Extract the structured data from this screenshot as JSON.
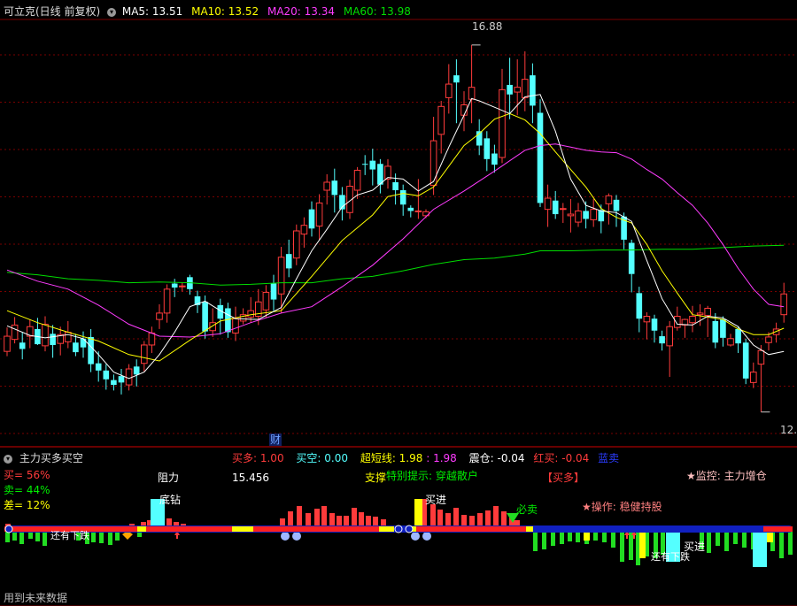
{
  "header": {
    "title": "可立克(日线 前复权)",
    "ma5": "MA5: 13.51",
    "ma10": "MA10: 13.52",
    "ma20": "MA20: 13.34",
    "ma60": "MA60: 13.98"
  },
  "colors": {
    "up": "#ff3b3b",
    "down": "#54ffff",
    "ma5": "#ffffff",
    "ma10": "#ffff00",
    "ma20": "#ff3cff",
    "ma60": "#00dd00",
    "grid": "#7a0000"
  },
  "price_labels": {
    "high": "16.88",
    "low": "12."
  },
  "cai_label": "财",
  "indicator": {
    "title": "主力买多买空",
    "buy_more": "买多: 1.00",
    "buy_empty": "买空: 0.00",
    "super_short": "超短线: 1.98",
    "super_short2": ": 1.98",
    "shock": "震仓: -0.04",
    "red_buy": "红买: -0.04",
    "blue_sell": "蓝卖",
    "buy_pct": "买= 56%",
    "sell_pct": "卖= 44%",
    "diff_pct": "差= 12%",
    "resistance_label": "阻力",
    "resistance_value": "15.456",
    "support_label": "支撑",
    "tip": "特别提示: 穿越散户",
    "tag": "【买多】",
    "monitor": "★监控: 主力增仓",
    "operation": "★操作: 稳健持股",
    "future": "用到未来数据",
    "sig_buy1": "买进",
    "sig_buy2": "买进",
    "sig_sell": "必卖",
    "sig_fall1": "还有下跌",
    "sig_fall2": "还有下跌",
    "sig_dip": "底钻"
  },
  "chart_data": {
    "type": "candlestick",
    "price_range": [
      11.9,
      17.2
    ],
    "high_mark": 16.88,
    "candles": [
      [
        13.04,
        13.23,
        13.34,
        12.98
      ],
      [
        13.19,
        13.37,
        13.47,
        13.14
      ],
      [
        13.15,
        13.07,
        13.28,
        12.94
      ],
      [
        13.23,
        13.35,
        13.44,
        13.08
      ],
      [
        13.32,
        13.13,
        13.46,
        13.12
      ],
      [
        13.11,
        13.38,
        13.48,
        13.04
      ],
      [
        13.26,
        13.12,
        13.37,
        12.96
      ],
      [
        13.14,
        13.25,
        13.35,
        12.99
      ],
      [
        13.16,
        13.28,
        13.42,
        13.08
      ],
      [
        13.15,
        13.03,
        13.26,
        12.98
      ],
      [
        13.2,
        13.09,
        13.29,
        12.96
      ],
      [
        13.22,
        12.88,
        13.32,
        12.78
      ],
      [
        12.89,
        12.8,
        13.04,
        12.66
      ],
      [
        12.8,
        12.69,
        12.88,
        12.56
      ],
      [
        12.68,
        12.62,
        12.75,
        12.55
      ],
      [
        12.73,
        12.65,
        12.82,
        12.5
      ],
      [
        12.62,
        12.82,
        12.88,
        12.55
      ],
      [
        12.85,
        12.75,
        12.94,
        12.6
      ],
      [
        12.89,
        13.12,
        13.17,
        12.79
      ],
      [
        13.12,
        13.27,
        13.35,
        13.02
      ],
      [
        13.44,
        13.52,
        13.63,
        13.32
      ],
      [
        13.52,
        13.82,
        13.88,
        13.4
      ],
      [
        13.89,
        13.84,
        13.95,
        13.72
      ],
      [
        13.86,
        13.86,
        13.9,
        13.79
      ],
      [
        13.97,
        13.82,
        14.0,
        13.75
      ],
      [
        13.73,
        13.62,
        13.8,
        13.52
      ],
      [
        13.66,
        13.29,
        13.74,
        13.2
      ],
      [
        13.3,
        13.4,
        13.58,
        13.22
      ],
      [
        13.62,
        13.45,
        13.7,
        13.25
      ],
      [
        13.58,
        13.28,
        13.65,
        13.21
      ],
      [
        13.27,
        13.45,
        13.6,
        13.17
      ],
      [
        13.42,
        13.5,
        13.58,
        13.38
      ],
      [
        13.47,
        13.55,
        13.72,
        13.4
      ],
      [
        13.48,
        13.66,
        13.82,
        13.37
      ],
      [
        13.56,
        13.78,
        13.87,
        13.46
      ],
      [
        13.89,
        13.69,
        14.0,
        13.55
      ],
      [
        13.76,
        14.22,
        14.35,
        13.52
      ],
      [
        14.26,
        14.08,
        14.44,
        13.97
      ],
      [
        14.21,
        14.55,
        14.63,
        14.12
      ],
      [
        14.51,
        14.62,
        14.72,
        14.34
      ],
      [
        14.82,
        14.58,
        14.92,
        14.48
      ],
      [
        14.61,
        14.9,
        15.01,
        14.44
      ],
      [
        15.06,
        15.16,
        15.26,
        14.88
      ],
      [
        15.18,
        15.0,
        15.33,
        14.78
      ],
      [
        15.0,
        14.82,
        15.1,
        14.68
      ],
      [
        14.78,
        15.11,
        15.19,
        14.7
      ],
      [
        15.06,
        15.31,
        15.35,
        14.95
      ],
      [
        15.39,
        15.38,
        15.5,
        15.25
      ],
      [
        15.43,
        15.32,
        15.58,
        15.12
      ],
      [
        15.39,
        15.13,
        15.45,
        15.02
      ],
      [
        15.2,
        15.36,
        15.45,
        15.08
      ],
      [
        15.16,
        15.06,
        15.27,
        14.88
      ],
      [
        15.06,
        14.88,
        15.13,
        14.74
      ],
      [
        14.84,
        14.8,
        14.87,
        14.72
      ],
      [
        14.79,
        14.8,
        15.2,
        14.7
      ],
      [
        14.74,
        14.79,
        14.82,
        14.71
      ],
      [
        15.12,
        15.68,
        15.98,
        15.0
      ],
      [
        15.76,
        16.11,
        16.18,
        15.52
      ],
      [
        16.22,
        16.39,
        16.64,
        16.02
      ],
      [
        16.5,
        16.41,
        16.7,
        15.9
      ],
      [
        16.0,
        16.13,
        16.3,
        15.8
      ],
      [
        16.2,
        16.35,
        16.88,
        15.9
      ],
      [
        15.8,
        15.62,
        15.95,
        15.5
      ],
      [
        15.71,
        15.45,
        15.8,
        15.3
      ],
      [
        15.52,
        15.38,
        15.63,
        15.28
      ],
      [
        15.47,
        16.32,
        16.58,
        15.4
      ],
      [
        16.38,
        16.26,
        16.72,
        15.95
      ],
      [
        16.29,
        16.35,
        16.7,
        16.0
      ],
      [
        16.22,
        16.45,
        16.8,
        16.05
      ],
      [
        16.5,
        16.12,
        16.65,
        15.9
      ],
      [
        16.03,
        14.9,
        16.2,
        14.85
      ],
      [
        14.82,
        14.96,
        15.13,
        14.6
      ],
      [
        14.93,
        14.76,
        15.05,
        14.7
      ],
      [
        14.82,
        14.83,
        14.9,
        14.65
      ],
      [
        14.74,
        14.76,
        14.95,
        14.53
      ],
      [
        14.66,
        14.8,
        14.9,
        14.6
      ],
      [
        14.8,
        14.7,
        14.92,
        14.58
      ],
      [
        14.69,
        14.82,
        14.95,
        14.6
      ],
      [
        14.81,
        14.67,
        14.88,
        14.52
      ],
      [
        14.89,
        14.99,
        15.02,
        14.63
      ],
      [
        14.94,
        14.8,
        15.0,
        14.6
      ],
      [
        14.73,
        14.44,
        14.78,
        14.32
      ],
      [
        14.4,
        14.01,
        14.44,
        13.78
      ],
      [
        13.77,
        13.45,
        13.85,
        13.28
      ],
      [
        13.41,
        13.48,
        13.53,
        13.19
      ],
      [
        13.45,
        13.3,
        13.5,
        13.15
      ],
      [
        13.23,
        13.14,
        13.3,
        13.05
      ],
      [
        13.11,
        13.35,
        13.42,
        12.72
      ],
      [
        13.34,
        13.48,
        13.6,
        13.3
      ],
      [
        13.37,
        13.44,
        13.45,
        13.21
      ],
      [
        13.4,
        13.48,
        13.61,
        13.28
      ],
      [
        13.5,
        13.52,
        13.63,
        13.36
      ],
      [
        13.49,
        13.58,
        13.61,
        13.22
      ],
      [
        13.42,
        13.15,
        13.52,
        13.08
      ],
      [
        13.44,
        13.21,
        13.48,
        13.1
      ],
      [
        13.12,
        13.2,
        13.26,
        13.1
      ],
      [
        13.32,
        13.14,
        13.35,
        13.02
      ],
      [
        13.15,
        12.7,
        13.2,
        12.63
      ],
      [
        12.65,
        12.78,
        12.9,
        12.58
      ],
      [
        12.88,
        13.05,
        13.12,
        12.28
      ],
      [
        13.15,
        13.22,
        13.28,
        13.05
      ],
      [
        13.25,
        13.32,
        13.4,
        13.15
      ],
      [
        13.5,
        13.76,
        13.9,
        13.4
      ]
    ],
    "ma5": [
      [
        0,
        13.36
      ],
      [
        3,
        13.24
      ],
      [
        5,
        13.21
      ],
      [
        8,
        13.25
      ],
      [
        10,
        13.2
      ],
      [
        12,
        13.0
      ],
      [
        14,
        12.78
      ],
      [
        16,
        12.7
      ],
      [
        18,
        12.78
      ],
      [
        20,
        13.0
      ],
      [
        22,
        13.28
      ],
      [
        24,
        13.6
      ],
      [
        26,
        13.67
      ],
      [
        28,
        13.55
      ],
      [
        30,
        13.45
      ],
      [
        33,
        13.44
      ],
      [
        36,
        13.59
      ],
      [
        38,
        13.95
      ],
      [
        40,
        14.3
      ],
      [
        42,
        14.57
      ],
      [
        44,
        14.85
      ],
      [
        46,
        15.0
      ],
      [
        48,
        15.06
      ],
      [
        50,
        15.22
      ],
      [
        52,
        15.2
      ],
      [
        54,
        15.05
      ],
      [
        56,
        15.17
      ],
      [
        58,
        15.6
      ],
      [
        60,
        16.0
      ],
      [
        61,
        16.21
      ],
      [
        62,
        16.18
      ],
      [
        64,
        16.1
      ],
      [
        66,
        16.02
      ],
      [
        68,
        16.23
      ],
      [
        70,
        16.26
      ],
      [
        72,
        15.8
      ],
      [
        74,
        15.2
      ],
      [
        76,
        14.87
      ],
      [
        78,
        14.8
      ],
      [
        80,
        14.78
      ],
      [
        82,
        14.67
      ],
      [
        84,
        14.18
      ],
      [
        86,
        13.7
      ],
      [
        88,
        13.38
      ],
      [
        90,
        13.37
      ],
      [
        92,
        13.48
      ],
      [
        94,
        13.46
      ],
      [
        96,
        13.35
      ],
      [
        98,
        13.12
      ],
      [
        100,
        13.0
      ],
      [
        102,
        13.04
      ]
    ],
    "ma10": [
      [
        0,
        13.55
      ],
      [
        4,
        13.4
      ],
      [
        8,
        13.28
      ],
      [
        12,
        13.17
      ],
      [
        16,
        13.0
      ],
      [
        20,
        12.92
      ],
      [
        24,
        13.18
      ],
      [
        28,
        13.42
      ],
      [
        32,
        13.5
      ],
      [
        36,
        13.55
      ],
      [
        40,
        13.98
      ],
      [
        44,
        14.43
      ],
      [
        48,
        14.75
      ],
      [
        50,
        14.98
      ],
      [
        52,
        15.02
      ],
      [
        54,
        14.99
      ],
      [
        56,
        15.1
      ],
      [
        58,
        15.36
      ],
      [
        60,
        15.62
      ],
      [
        62,
        15.77
      ],
      [
        64,
        15.95
      ],
      [
        66,
        16.02
      ],
      [
        68,
        15.94
      ],
      [
        70,
        15.77
      ],
      [
        72,
        15.54
      ],
      [
        74,
        15.32
      ],
      [
        76,
        15.1
      ],
      [
        78,
        14.83
      ],
      [
        80,
        14.72
      ],
      [
        82,
        14.65
      ],
      [
        84,
        14.38
      ],
      [
        86,
        14.05
      ],
      [
        88,
        13.77
      ],
      [
        90,
        13.5
      ],
      [
        92,
        13.47
      ],
      [
        94,
        13.44
      ],
      [
        96,
        13.32
      ],
      [
        98,
        13.25
      ],
      [
        100,
        13.25
      ],
      [
        102,
        13.33
      ]
    ],
    "ma20": [
      [
        0,
        14.06
      ],
      [
        4,
        13.92
      ],
      [
        8,
        13.82
      ],
      [
        12,
        13.62
      ],
      [
        16,
        13.38
      ],
      [
        20,
        13.23
      ],
      [
        24,
        13.22
      ],
      [
        28,
        13.26
      ],
      [
        32,
        13.4
      ],
      [
        36,
        13.52
      ],
      [
        40,
        13.6
      ],
      [
        44,
        13.85
      ],
      [
        48,
        14.12
      ],
      [
        52,
        14.45
      ],
      [
        56,
        14.82
      ],
      [
        60,
        15.05
      ],
      [
        64,
        15.3
      ],
      [
        68,
        15.56
      ],
      [
        70,
        15.62
      ],
      [
        72,
        15.64
      ],
      [
        74,
        15.6
      ],
      [
        76,
        15.56
      ],
      [
        78,
        15.54
      ],
      [
        80,
        15.53
      ],
      [
        82,
        15.45
      ],
      [
        84,
        15.32
      ],
      [
        86,
        15.2
      ],
      [
        88,
        15.03
      ],
      [
        90,
        14.87
      ],
      [
        92,
        14.65
      ],
      [
        94,
        14.38
      ],
      [
        96,
        14.08
      ],
      [
        98,
        13.82
      ],
      [
        100,
        13.63
      ],
      [
        102,
        13.6
      ]
    ],
    "ma60": [
      [
        0,
        14.03
      ],
      [
        4,
        14.0
      ],
      [
        8,
        13.95
      ],
      [
        12,
        13.93
      ],
      [
        16,
        13.9
      ],
      [
        20,
        13.91
      ],
      [
        24,
        13.9
      ],
      [
        28,
        13.87
      ],
      [
        32,
        13.88
      ],
      [
        36,
        13.9
      ],
      [
        40,
        13.9
      ],
      [
        44,
        13.95
      ],
      [
        48,
        13.98
      ],
      [
        52,
        14.05
      ],
      [
        56,
        14.13
      ],
      [
        60,
        14.19
      ],
      [
        64,
        14.21
      ],
      [
        68,
        14.26
      ],
      [
        70,
        14.3
      ],
      [
        74,
        14.3
      ],
      [
        78,
        14.31
      ],
      [
        82,
        14.31
      ],
      [
        86,
        14.32
      ],
      [
        90,
        14.32
      ],
      [
        94,
        14.34
      ],
      [
        98,
        14.36
      ],
      [
        102,
        14.37
      ]
    ]
  }
}
